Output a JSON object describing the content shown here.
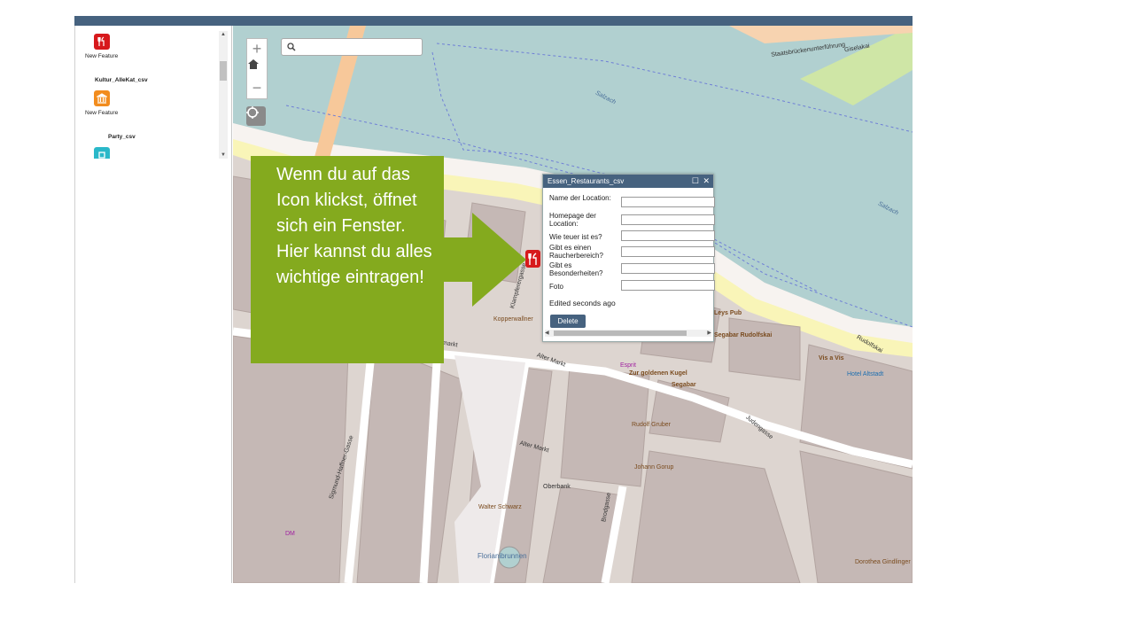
{
  "sidebar": {
    "items": [
      {
        "label": "New Feature",
        "icon": "restaurant-icon",
        "color": "#d7191c"
      },
      {
        "label": "Kultur_AlleKat_csv",
        "type": "heading"
      },
      {
        "label": "New Feature",
        "icon": "museum-icon",
        "color": "#f28c1e"
      },
      {
        "label": "Party_csv",
        "type": "heading"
      },
      {
        "label": "",
        "icon": "party-icon",
        "color": "#2ab8c9"
      }
    ]
  },
  "map": {
    "search": {
      "placeholder": ""
    },
    "controls": {
      "zoom_in": "+",
      "home": "home-icon",
      "zoom_out": "−",
      "locate": "locate-icon"
    },
    "labels": [
      "Staatsbrückenunterführung",
      "Giselakai",
      "Salzach",
      "Salzach",
      "Klampferergasse",
      "Alter Markt",
      "Alter Markt",
      "Alter Markt",
      "Zur goldenen Kugel",
      "Segabar",
      "Segabar Rudolfskai",
      "Vis a Vis",
      "Hotel Altstadt",
      "Rudolfskai",
      "Judengasse",
      "Sigmund-Haffner-Gasse",
      "Brodgasse",
      "Oberbank",
      "Walter Schwarz",
      "Florianibrunnen",
      "Rudolf Gruber",
      "Johann Gorup",
      "Dorothea Gindlinger",
      "Esprit",
      "DM",
      "Kopperwallner",
      "Leys Pub",
      "markt"
    ]
  },
  "popup": {
    "title": "Essen_Restaurants_csv",
    "fields": [
      {
        "label": "Name der Location:",
        "value": ""
      },
      {
        "label": "Homepage der Location:",
        "value": ""
      },
      {
        "label": "Wie teuer ist es?",
        "value": ""
      },
      {
        "label": "Gibt es einen Raucherbereich?",
        "value": ""
      },
      {
        "label": "Gibt es Besonderheiten?",
        "value": ""
      },
      {
        "label": "Foto",
        "value": ""
      }
    ],
    "edited_text": "Edited seconds ago",
    "delete_label": "Delete"
  },
  "callout": {
    "text": "Wenn du auf das Icon klickst, öffnet sich ein Fenster. Hier kannst du alles wichtige eintragen!",
    "color": "#84aa1e"
  },
  "colors": {
    "header": "#46627f",
    "river": "#b1d0d0",
    "building": "#c5b8b5"
  }
}
